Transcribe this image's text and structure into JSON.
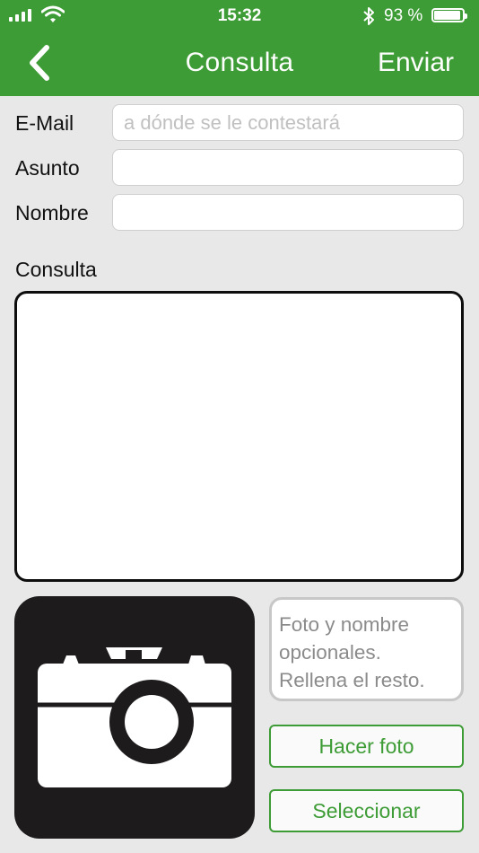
{
  "status_bar": {
    "time": "15:32",
    "battery_text": "93 %"
  },
  "nav": {
    "title": "Consulta",
    "send_label": "Enviar"
  },
  "form": {
    "email_label": "E-Mail",
    "email_placeholder": "a dónde se le contestará",
    "subject_label": "Asunto",
    "name_label": "Nombre",
    "query_label": "Consulta"
  },
  "photo_section": {
    "hint_lines": [
      "Foto y nombre",
      "opcionales.",
      "Rellena el resto."
    ],
    "take_photo_label": "Hacer foto",
    "select_label": "Seleccionar"
  },
  "colors": {
    "brand_green": "#3d9c35",
    "background": "#e8e8e8"
  },
  "icons": {
    "back": "chevron-left-icon",
    "photo": "camera-icon"
  }
}
